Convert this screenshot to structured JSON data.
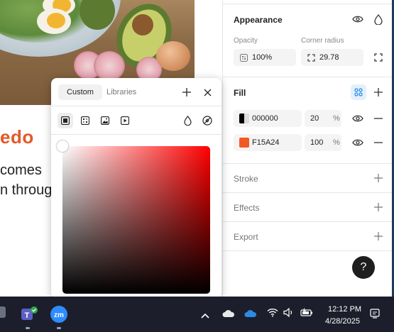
{
  "canvas": {
    "title_fragment": "edo",
    "text_line1": "comes",
    "text_line2": "n through"
  },
  "color_picker": {
    "tabs": [
      "Custom",
      "Libraries"
    ],
    "active_tab": "Custom",
    "fill_types": [
      "solid-icon",
      "gradient-icon",
      "image-icon",
      "video-icon"
    ],
    "tool_icons": [
      "opacity-drop-icon",
      "eyedropper-icon"
    ],
    "selected_color": "#ff0000"
  },
  "appearance": {
    "title": "Appearance",
    "opacity_label": "Opacity",
    "opacity_value": "100%",
    "corner_radius_label": "Corner radius",
    "corner_radius_value": "29.78"
  },
  "fill": {
    "title": "Fill",
    "layers": [
      {
        "hex": "000000",
        "opacity": "20",
        "unit": "%",
        "swatch_color": "#000000"
      },
      {
        "hex": "F15A24",
        "opacity": "100",
        "unit": "%",
        "swatch_color": "#F15A24"
      }
    ]
  },
  "sections": {
    "stroke": "Stroke",
    "effects": "Effects",
    "export": "Export"
  },
  "help": {
    "label": "?"
  },
  "taskbar": {
    "time": "12:12 PM",
    "date": "4/28/2025",
    "apps": [
      "teams-icon",
      "zoom-icon"
    ],
    "tray": [
      "chevron-up-icon",
      "cloud-icon",
      "onedrive-icon",
      "wifi-icon",
      "volume-icon",
      "battery-icon",
      "notification-icon"
    ]
  },
  "colors": {
    "accent_orange": "#e35a2a",
    "fill_accent": "#F15A24",
    "taskbar_bg": "#1c1f2b",
    "selection_blue": "#1e88e5"
  }
}
